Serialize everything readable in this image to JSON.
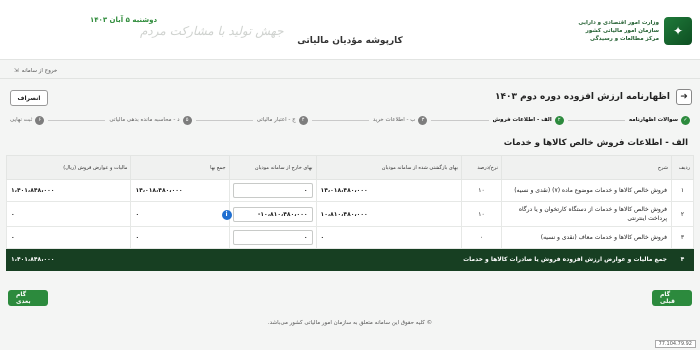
{
  "header": {
    "app_title": "کارپوشه مؤدیان مالیاتی",
    "slogan_date": "۱۴۰۳ دوشنبه ۵ آبان",
    "slogan_text": "جهش تولید با مشارکت مردم",
    "org_line1": "وزارت امور اقتصادی و دارایی",
    "org_line2": "سازمان امور مالیاتی کشور",
    "org_line3": "مرکز مطالعات و رسیدگی"
  },
  "nav": {
    "back_link": "خروج از سامانه"
  },
  "page": {
    "heading": "اظهارنامه ارزش افزوده دوره دوم ۱۴۰۳",
    "cancel_label": "انصراف",
    "section_title": "الف - اطلاعات فروش خالص کالاها و خدمات"
  },
  "steps": [
    {
      "num": "✓",
      "label": "سوالات اظهارنامه",
      "state": "done"
    },
    {
      "num": "۲",
      "label": "الف - اطلاعات فروش",
      "state": "active"
    },
    {
      "num": "۳",
      "label": "ب - اطلاعات خرید",
      "state": "todo"
    },
    {
      "num": "۴",
      "label": "ج - اعتبار مالیاتی",
      "state": "todo"
    },
    {
      "num": "۵",
      "label": "د - محاسبه مانده بدهی مالیاتی",
      "state": "todo"
    },
    {
      "num": "۶",
      "label": "ثبت نهایی",
      "state": "todo"
    }
  ],
  "table": {
    "headers": [
      "ردیف",
      "شرح",
      "نرخ/درصد",
      "بهای بازگشتی شده از سامانه مودیان",
      "بهای خارج از سامانه مودیان",
      "جمع بها",
      "مالیات و عوارض فروش (ریال)"
    ],
    "rows": [
      {
        "idx": "۱",
        "desc": "فروش خالص کالاها و خدمات موضوع ماده (۷) (نقدی و نسیه)",
        "rate": "۱۰",
        "system": "۱۴،۰۱۸،۴۸۰،۰۰۰",
        "outside": "۰",
        "total": "۱۴،۰۱۸،۴۸۰،۰۰۰",
        "tax": "۱،۴۰۱،۸۴۸،۰۰۰"
      },
      {
        "idx": "۲",
        "desc": "فروش خالص کالاها و خدمات از دستگاه کارتخوان و یا درگاه پرداخت اینترنتی",
        "rate": "۱۰",
        "system": "۱۰،۸۱۰،۴۸۰،۰۰۰",
        "outside": "-۱۰،۸۱۰،۴۸۰،۰۰۰",
        "total": "۰",
        "tax": "۰"
      },
      {
        "idx": "۳",
        "desc": "فروش خالص کالاها و خدمات معاف (نقدی و نسیه)",
        "rate": "۰",
        "system": "۰",
        "outside": "۰",
        "total": "۰",
        "tax": "۰"
      }
    ],
    "total_row": {
      "idx": "۴",
      "desc": "جمع مالیات و عوارض ارزش افزوده فروش یا صادرات کالاها و خدمات",
      "tax": "۱،۴۰۱،۸۴۸،۰۰۰"
    }
  },
  "buttons": {
    "next": "گام بعدی",
    "prev": "گام قبلی"
  },
  "footer": {
    "copyright": "© کلیه حقوق این سامانه متعلق به سازمان امور مالیاتی کشور می‌باشد.",
    "ip": "77.104.79.92"
  },
  "colors": {
    "accent": "#2c8a3d",
    "total_row": "#173f22",
    "info": "#1f6fd1"
  }
}
